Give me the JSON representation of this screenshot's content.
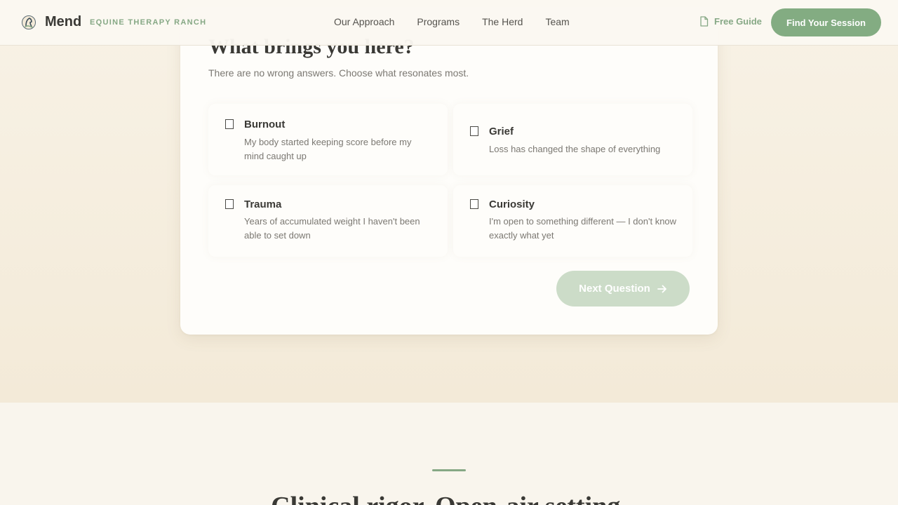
{
  "header": {
    "brand": "Mend",
    "tagline": "EQUINE THERAPY RANCH",
    "nav": [
      {
        "label": "Our Approach"
      },
      {
        "label": "Programs"
      },
      {
        "label": "The Herd"
      },
      {
        "label": "Team"
      }
    ],
    "guide_label": "Free Guide",
    "cta_label": "Find Your Session",
    "logo_icon": "horse-head-icon",
    "guide_icon": "document-icon"
  },
  "quiz": {
    "question": "What brings you here?",
    "subtitle": "There are no wrong answers. Choose what resonates most.",
    "options": [
      {
        "label": "Burnout",
        "description": "My body started keeping score before my mind caught up",
        "checked": false
      },
      {
        "label": "Grief",
        "description": "Loss has changed the shape of everything",
        "checked": false
      },
      {
        "label": "Trauma",
        "description": "Years of accumulated weight I haven't been able to set down",
        "checked": false
      },
      {
        "label": "Curiosity",
        "description": "I'm open to something different — I don't know exactly what yet",
        "checked": false
      }
    ],
    "next_label": "Next Question",
    "next_icon": "arrow-right-icon"
  },
  "section": {
    "title": "Clinical rigor. Open-air setting."
  },
  "colors": {
    "accent": "#83ac82",
    "accent_light": "#ccdcc8",
    "text": "#3a3935",
    "muted": "#7b7872",
    "background": "#f3ead8"
  }
}
